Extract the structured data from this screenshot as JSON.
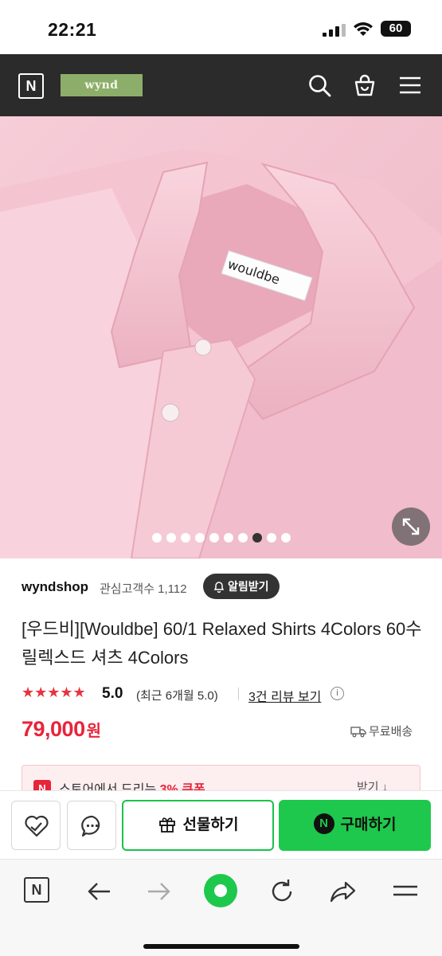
{
  "status_bar": {
    "time": "22:21",
    "battery": "60"
  },
  "header": {
    "naver_logo": "N",
    "brand_label": "wynd",
    "icons": [
      "search-icon",
      "shopping-bag-icon",
      "menu-icon"
    ]
  },
  "product_image": {
    "collar_label": "wouldbe",
    "slide_count": 10,
    "active_slide": 8
  },
  "seller": {
    "name": "wyndshop",
    "fans": "관심고객수 1,112",
    "alarm_label": "알림받기"
  },
  "product": {
    "title": "[우드비][Wouldbe] 60/1 Relaxed Shirts 4Colors 60수 릴렉스드 셔츠 4Colors",
    "stars": "★★★★★",
    "score": "5.0",
    "recent_rating": "(최근 6개월 5.0)",
    "review_link": "3건 리뷰 보기",
    "info_glyph": "i",
    "price": "79,000",
    "currency": "원",
    "shipping": "무료배송",
    "accent_color": "#e8243a"
  },
  "coupon": {
    "icon": "N",
    "text_before": "스토어에서 드리는 ",
    "text_highlight": "3% 쿠폰",
    "get_label": "받기 ↓"
  },
  "action_bar": {
    "gift_label": "선물하기",
    "buy_label": "구매하기",
    "buy_icon": "N",
    "buy_color": "#1ec84c"
  },
  "browser_bar": {
    "naver_logo": "N",
    "icons": [
      "naver-icon",
      "back-arrow-icon",
      "forward-arrow-icon",
      "home-green-icon",
      "refresh-icon",
      "share-icon",
      "menu-icon"
    ]
  }
}
